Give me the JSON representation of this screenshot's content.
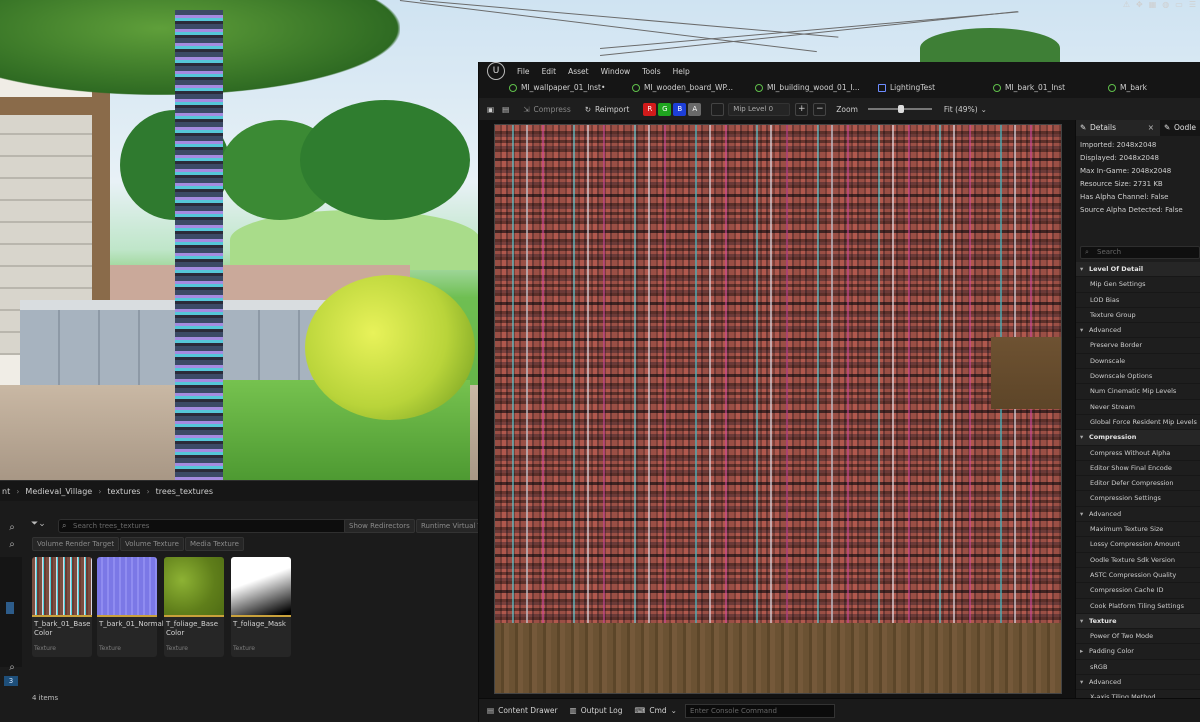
{
  "system_icons": [
    "warning-icon",
    "move-icon",
    "grid-icon",
    "world-icon",
    "ruler-icon",
    "layers-icon"
  ],
  "content_browser": {
    "breadcrumb": [
      "nt",
      "Medieval_Village",
      "textures",
      "trees_textures"
    ],
    "search_placeholder": "Search trees_textures",
    "filter_chips": [
      "Show Redirectors",
      "Runtime Virtual Te"
    ],
    "type_chips": [
      "Volume Render Target",
      "Volume Texture",
      "Media Texture"
    ],
    "assets": [
      {
        "name": "T_bark_01_Base Color",
        "type": "Texture",
        "color": "#7a4e40"
      },
      {
        "name": "T_bark_01_Normal",
        "type": "Texture",
        "color": "#7b78e6"
      },
      {
        "name": "T_foliage_Base Color",
        "type": "Texture",
        "color": "#6b8f20"
      },
      {
        "name": "T_foliage_Mask",
        "type": "Texture",
        "color": "#ffffff"
      }
    ],
    "count": "4 items",
    "left_badge": "3"
  },
  "editor": {
    "menu": [
      "File",
      "Edit",
      "Asset",
      "Window",
      "Tools",
      "Help"
    ],
    "tabs": [
      {
        "label": "MI_wallpaper_01_Inst•",
        "icon": "material-instance-icon"
      },
      {
        "label": "MI_wooden_board_WP...",
        "icon": "material-instance-icon"
      },
      {
        "label": "MI_building_wood_01_I...",
        "icon": "material-instance-icon"
      },
      {
        "label": "LightingTest",
        "icon": "level-icon"
      },
      {
        "label": "MI_bark_01_Inst",
        "icon": "material-instance-icon"
      },
      {
        "label": "M_bark",
        "icon": "material-icon"
      }
    ],
    "toolbar": {
      "compress": "Compress",
      "reimport": "Reimport",
      "channels": [
        "R",
        "G",
        "B",
        "A"
      ],
      "mip_level": "Mip Level 0",
      "zoom_label": "Zoom",
      "zoom_value": "Fit (49%)"
    },
    "statusbar": {
      "content_drawer": "Content Drawer",
      "output_log": "Output Log",
      "cmd": "Cmd",
      "console_placeholder": "Enter Console Command"
    }
  },
  "details": {
    "tab_label": "Details",
    "tab2_label": "Oodle",
    "info": [
      "Imported: 2048x2048",
      "Displayed: 2048x2048",
      "Max In-Game: 2048x2048",
      "Resource Size: 2731 KB",
      "Has Alpha Channel: False",
      "Source Alpha Detected: False"
    ],
    "search_placeholder": "Search",
    "rows": [
      {
        "label": "Level Of Detail",
        "kind": "sec"
      },
      {
        "label": "Mip Gen Settings",
        "kind": "item"
      },
      {
        "label": "LOD Bias",
        "kind": "item"
      },
      {
        "label": "Texture Group",
        "kind": "item"
      },
      {
        "label": "Advanced",
        "kind": "sub"
      },
      {
        "label": "Preserve Border",
        "kind": "item"
      },
      {
        "label": "Downscale",
        "kind": "item"
      },
      {
        "label": "Downscale Options",
        "kind": "item"
      },
      {
        "label": "Num Cinematic Mip Levels",
        "kind": "item"
      },
      {
        "label": "Never Stream",
        "kind": "item"
      },
      {
        "label": "Global Force Resident Mip Levels",
        "kind": "item"
      },
      {
        "label": "Compression",
        "kind": "sec"
      },
      {
        "label": "Compress Without Alpha",
        "kind": "item"
      },
      {
        "label": "Editor Show Final Encode",
        "kind": "item"
      },
      {
        "label": "Editor Defer Compression",
        "kind": "item"
      },
      {
        "label": "Compression Settings",
        "kind": "item"
      },
      {
        "label": "Advanced",
        "kind": "sub"
      },
      {
        "label": "Maximum Texture Size",
        "kind": "item"
      },
      {
        "label": "Lossy Compression Amount",
        "kind": "item"
      },
      {
        "label": "Oodle Texture Sdk Version",
        "kind": "item"
      },
      {
        "label": "ASTC Compression Quality",
        "kind": "item"
      },
      {
        "label": "Compression Cache ID",
        "kind": "item"
      },
      {
        "label": "Cook Platform Tiling Settings",
        "kind": "item"
      },
      {
        "label": "Texture",
        "kind": "sec"
      },
      {
        "label": "Power Of Two Mode",
        "kind": "item"
      },
      {
        "label": "Padding Color",
        "kind": "sub2"
      },
      {
        "label": "sRGB",
        "kind": "item"
      },
      {
        "label": "Advanced",
        "kind": "sub"
      },
      {
        "label": "X-axis Tiling Method",
        "kind": "item"
      }
    ]
  }
}
